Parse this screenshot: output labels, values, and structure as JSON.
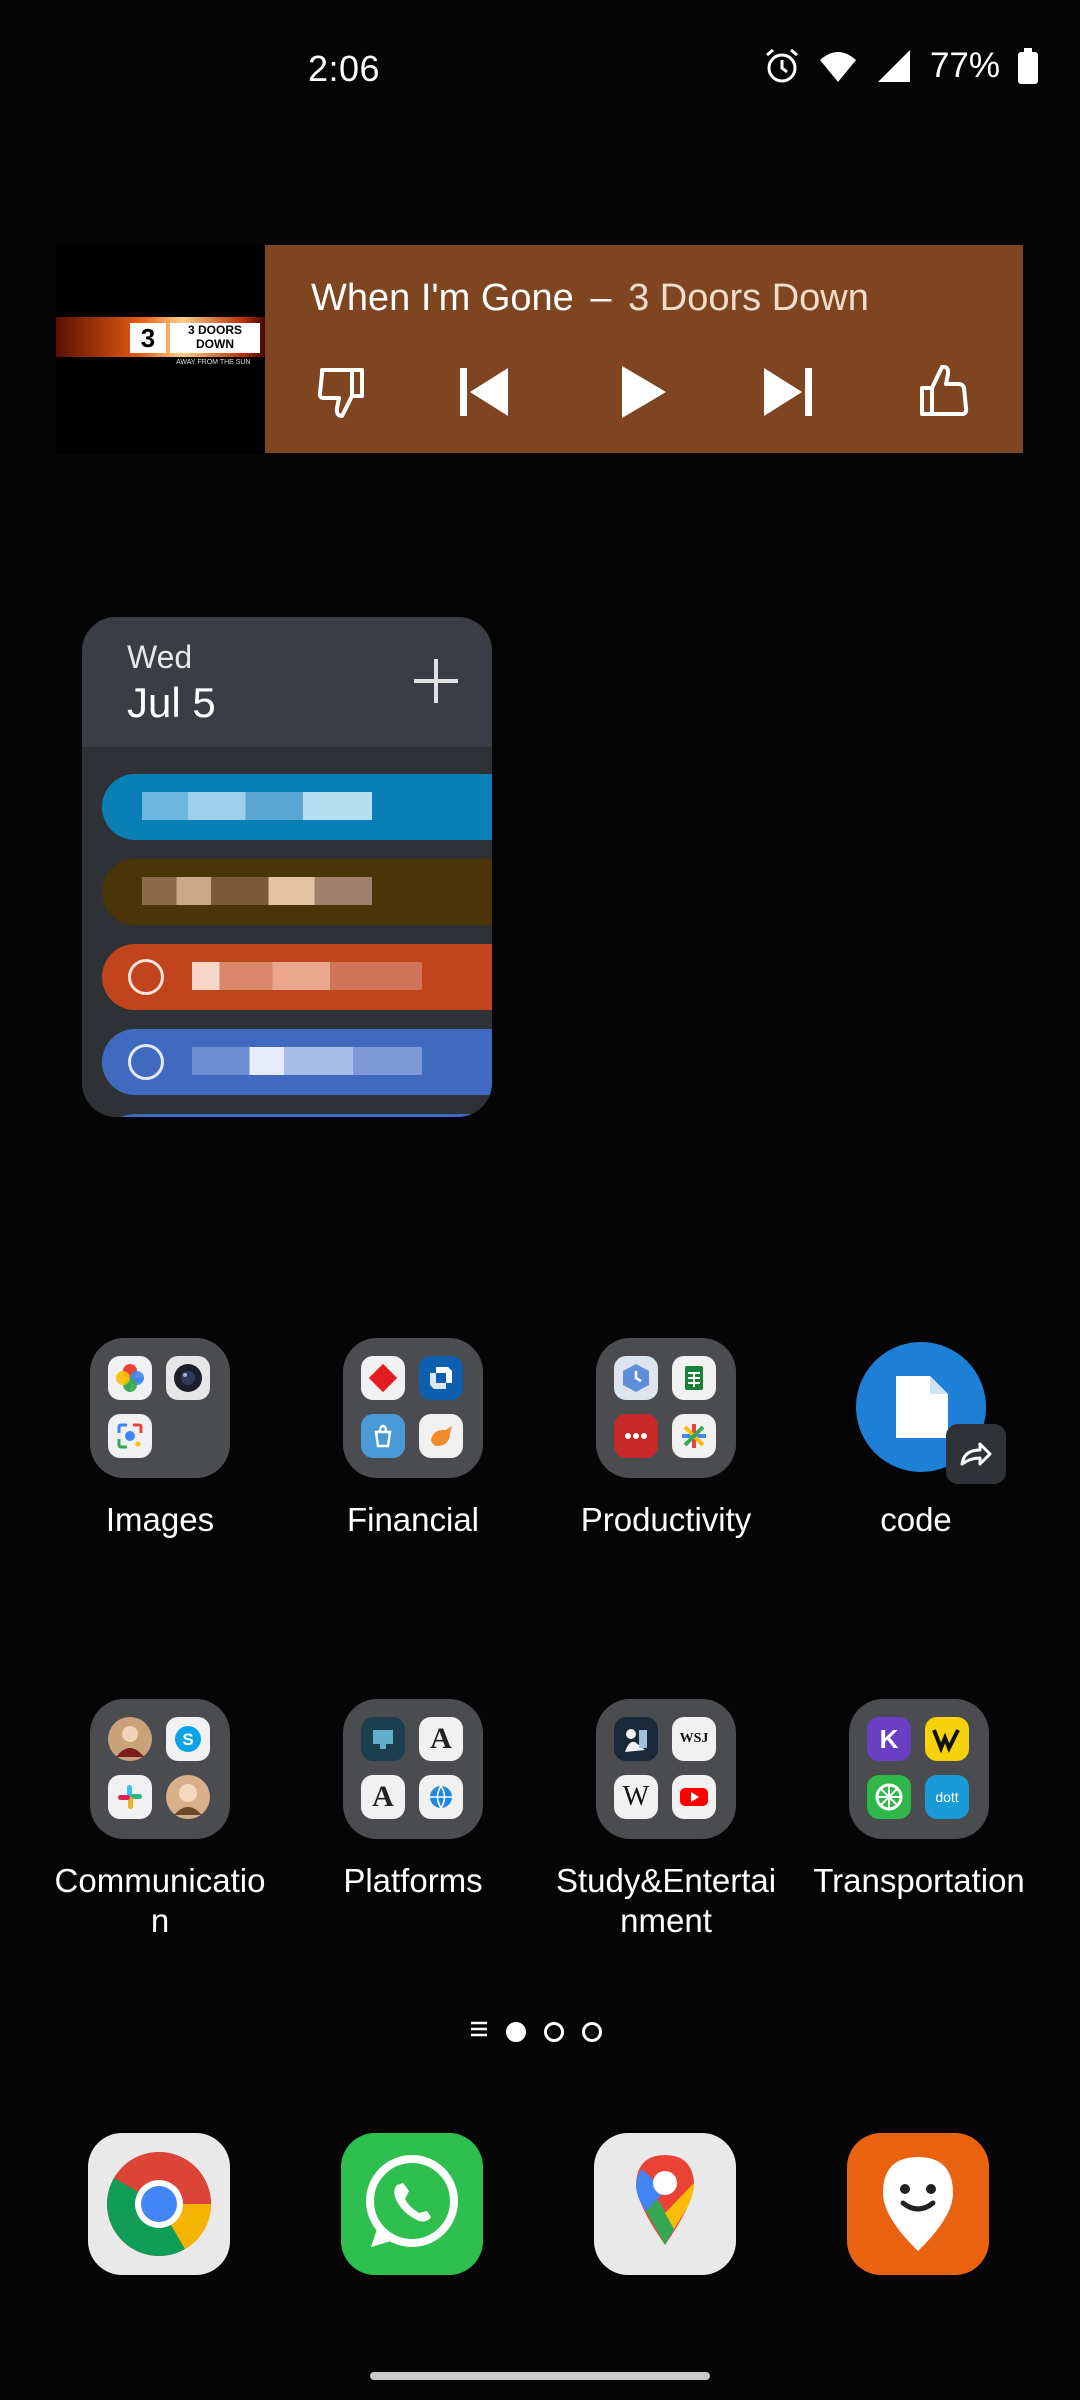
{
  "status_bar": {
    "time": "2:06",
    "battery": "77%",
    "icons": [
      "alarm-icon",
      "wifi-icon",
      "signal-icon",
      "battery-icon"
    ]
  },
  "music_widget": {
    "album_art_text": "3 DOORS DOWN",
    "album_art_subtitle": "AWAY FROM THE SUN",
    "song": "When I'm Gone",
    "separator": "–",
    "artist": "3 Doors Down",
    "background_color": "#7e4520",
    "controls": [
      "thumbs-down-icon",
      "skip-previous-icon",
      "play-icon",
      "skip-next-icon",
      "thumbs-up-icon"
    ]
  },
  "calendar_widget": {
    "day_of_week": "Wed",
    "date": "Jul 5",
    "add_icon": "plus-icon",
    "events_note": "event titles pixelated",
    "event_colors": [
      "#0a7fb5",
      "#4a3408",
      "#c2441c",
      "#3f6ac0"
    ]
  },
  "apps_row1": [
    {
      "label": "Images",
      "type": "folder"
    },
    {
      "label": "Financial",
      "type": "folder"
    },
    {
      "label": "Productivity",
      "type": "folder"
    },
    {
      "label": "code",
      "type": "shortcut"
    }
  ],
  "apps_row2": [
    {
      "label": "Communicatio\nn",
      "type": "folder"
    },
    {
      "label": "Platforms",
      "type": "folder"
    },
    {
      "label": "Study&Entertai\nnment",
      "type": "folder"
    },
    {
      "label": "Transportation",
      "type": "folder"
    }
  ],
  "page_indicator": {
    "pages": 3,
    "active": 1,
    "icon": "menu-lines-icon"
  },
  "dock": [
    "chrome-icon",
    "whatsapp-icon",
    "google-maps-icon",
    "citymapper-icon"
  ]
}
